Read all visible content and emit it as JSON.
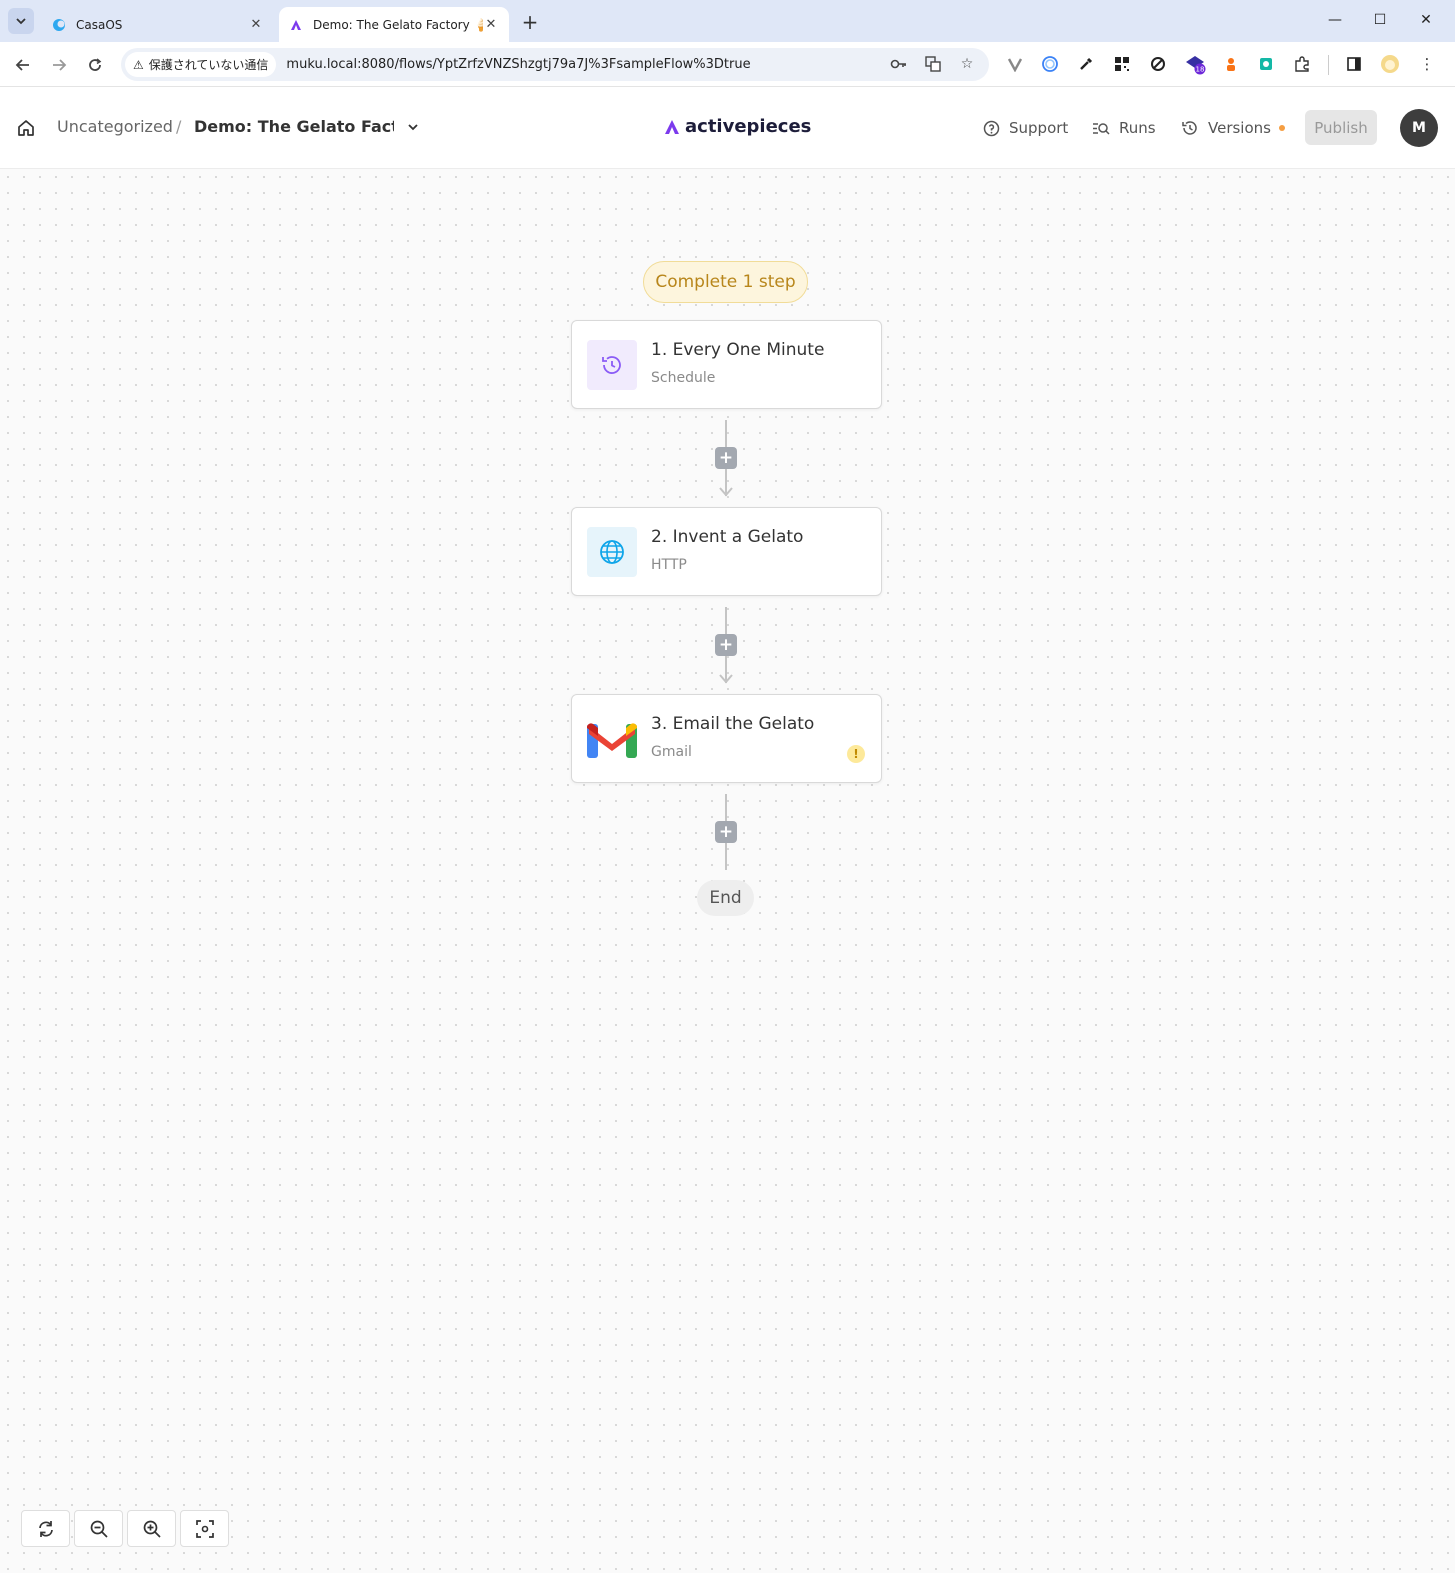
{
  "browser": {
    "tabs": [
      {
        "title": "CasaOS",
        "active": false
      },
      {
        "title": "Demo: The Gelato Factory 🍦 - A",
        "active": true
      }
    ],
    "security_label": "保護されていない通信",
    "url": "muku.local:8080/flows/YptZrfzVNZShzgtj79a7J%3FsampleFlow%3Dtrue",
    "extension_badge": "18"
  },
  "header": {
    "folder": "Uncategorized",
    "separator": "/",
    "flow_name": "Demo: The Gelato Fact...",
    "logo_text": "activepieces",
    "support_label": "Support",
    "runs_label": "Runs",
    "versions_label": "Versions",
    "publish_label": "Publish",
    "avatar_initial": "M"
  },
  "canvas": {
    "status_pill": "Complete 1 step",
    "steps": [
      {
        "title": "1. Every One Minute",
        "subtitle": "Schedule",
        "icon": "clock-icon"
      },
      {
        "title": "2. Invent a Gelato",
        "subtitle": "HTTP",
        "icon": "globe-icon"
      },
      {
        "title": "3. Email the Gelato",
        "subtitle": "Gmail",
        "icon": "gmail-icon",
        "warning": "!"
      }
    ],
    "add_label": "+",
    "end_label": "End"
  },
  "colors": {
    "accent": "#7c3aed",
    "pill_bg": "#fdf5dd",
    "pill_text": "#b8861b",
    "warning": "#f59e42"
  }
}
